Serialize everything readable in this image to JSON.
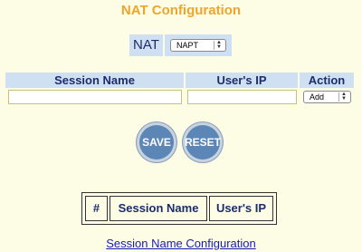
{
  "page": {
    "title": "NAT Configuration"
  },
  "nat": {
    "label": "NAT",
    "selected": "NAPT"
  },
  "session_form": {
    "headers": [
      "Session Name",
      "User's IP",
      "Action"
    ],
    "session_name_value": "",
    "users_ip_value": "",
    "action_selected": "Add"
  },
  "buttons": {
    "save": "SAVE",
    "reset": "RESET"
  },
  "sessions_table": {
    "headers": [
      "#",
      "Session Name",
      "User's IP"
    ]
  },
  "link": {
    "label": "Session Name Configuration"
  }
}
